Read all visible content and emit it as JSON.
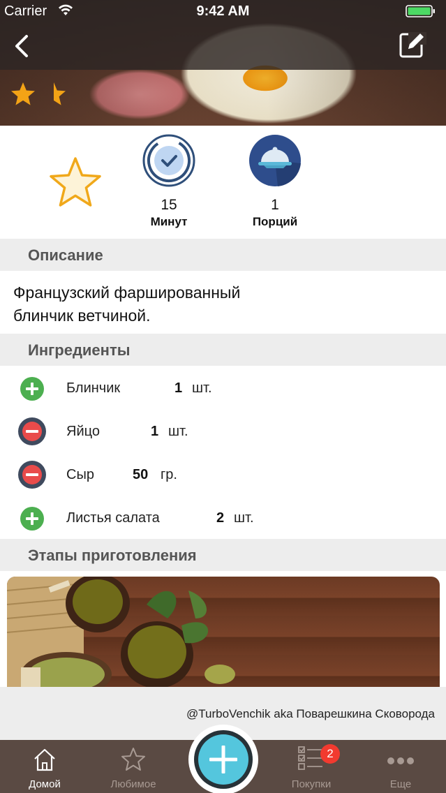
{
  "status_bar": {
    "carrier": "Carrier",
    "time": "9:42 AM"
  },
  "hero": {
    "rating": 1.5,
    "rating_max": 2
  },
  "stats": {
    "time_value": "15",
    "time_label": "Минут",
    "servings_value": "1",
    "servings_label": "Порций"
  },
  "description": {
    "header": "Описание",
    "text_line1": "Французский фаршированный",
    "text_line2": "блинчик ветчиной."
  },
  "ingredients": {
    "header": "Ингредиенты",
    "items": [
      {
        "name": "Блинчик",
        "qty": "1",
        "unit": "шт.",
        "status": "add"
      },
      {
        "name": "Яйцо",
        "qty": "1",
        "unit": "шт.",
        "status": "remove"
      },
      {
        "name": "Сыр",
        "qty": "50",
        "unit": "гр.",
        "status": "remove"
      },
      {
        "name": "Листья салата",
        "qty": "2",
        "unit": "шт.",
        "status": "add"
      }
    ]
  },
  "steps": {
    "header": "Этапы приготовления",
    "caption": "@TurboVenchik aka Поварешкина Сковорода"
  },
  "tabbar": {
    "home": "Домой",
    "favorites": "Любимое",
    "shopping": "Покупки",
    "shopping_badge": "2",
    "more": "Еще"
  },
  "colors": {
    "accent_green": "#4caf50",
    "remove_dark": "#3f4a5e",
    "remove_red": "#e94b4b",
    "star_gold": "#f3a316",
    "tabbar_bg": "#5a4a43",
    "fab_ring": "#54c6dd",
    "badge_red": "#f23a2f"
  },
  "icons": {
    "back": "chevron-left-icon",
    "edit": "edit-icon",
    "favorite": "star-outline-icon",
    "timer": "timer-check-icon",
    "servings": "cloche-icon",
    "add": "plus-circle-icon",
    "remove": "minus-circle-icon",
    "home_tab": "home-icon",
    "favorites_tab": "star-icon",
    "shopping_tab": "checklist-icon",
    "more_tab": "more-dots-icon",
    "fab": "plus-icon"
  }
}
